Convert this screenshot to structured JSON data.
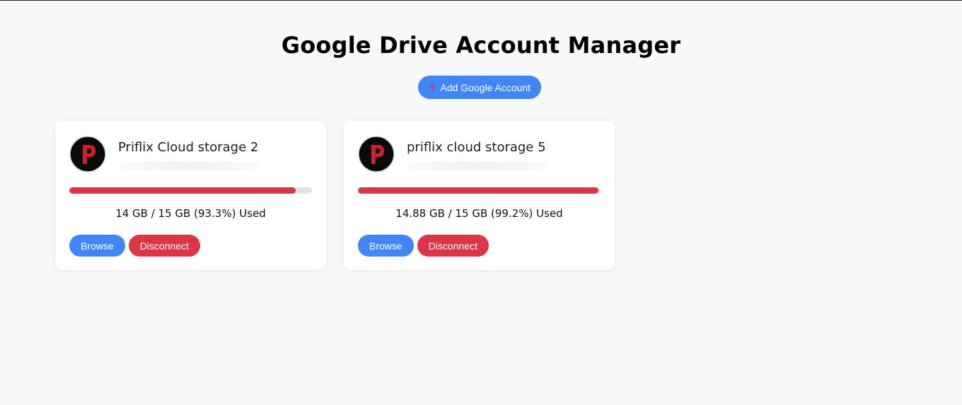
{
  "page": {
    "title": "Google Drive Account Manager",
    "add_button_label": "Add Google Account",
    "add_icon": "plus-icon"
  },
  "colors": {
    "primary": "#4285f4",
    "danger": "#dc3545",
    "background": "#f7f8fa"
  },
  "accounts": [
    {
      "name": "Priflix Cloud storage 2",
      "avatar_icon": "priflix-logo",
      "usage_text": "14 GB / 15 GB (93.3%) Used",
      "used_fraction": 0.933,
      "browse_label": "Browse",
      "disconnect_label": "Disconnect"
    },
    {
      "name": "priflix cloud storage 5",
      "avatar_icon": "priflix-logo",
      "usage_text": "14.88 GB / 15 GB (99.2%) Used",
      "used_fraction": 0.992,
      "browse_label": "Browse",
      "disconnect_label": "Disconnect"
    }
  ]
}
